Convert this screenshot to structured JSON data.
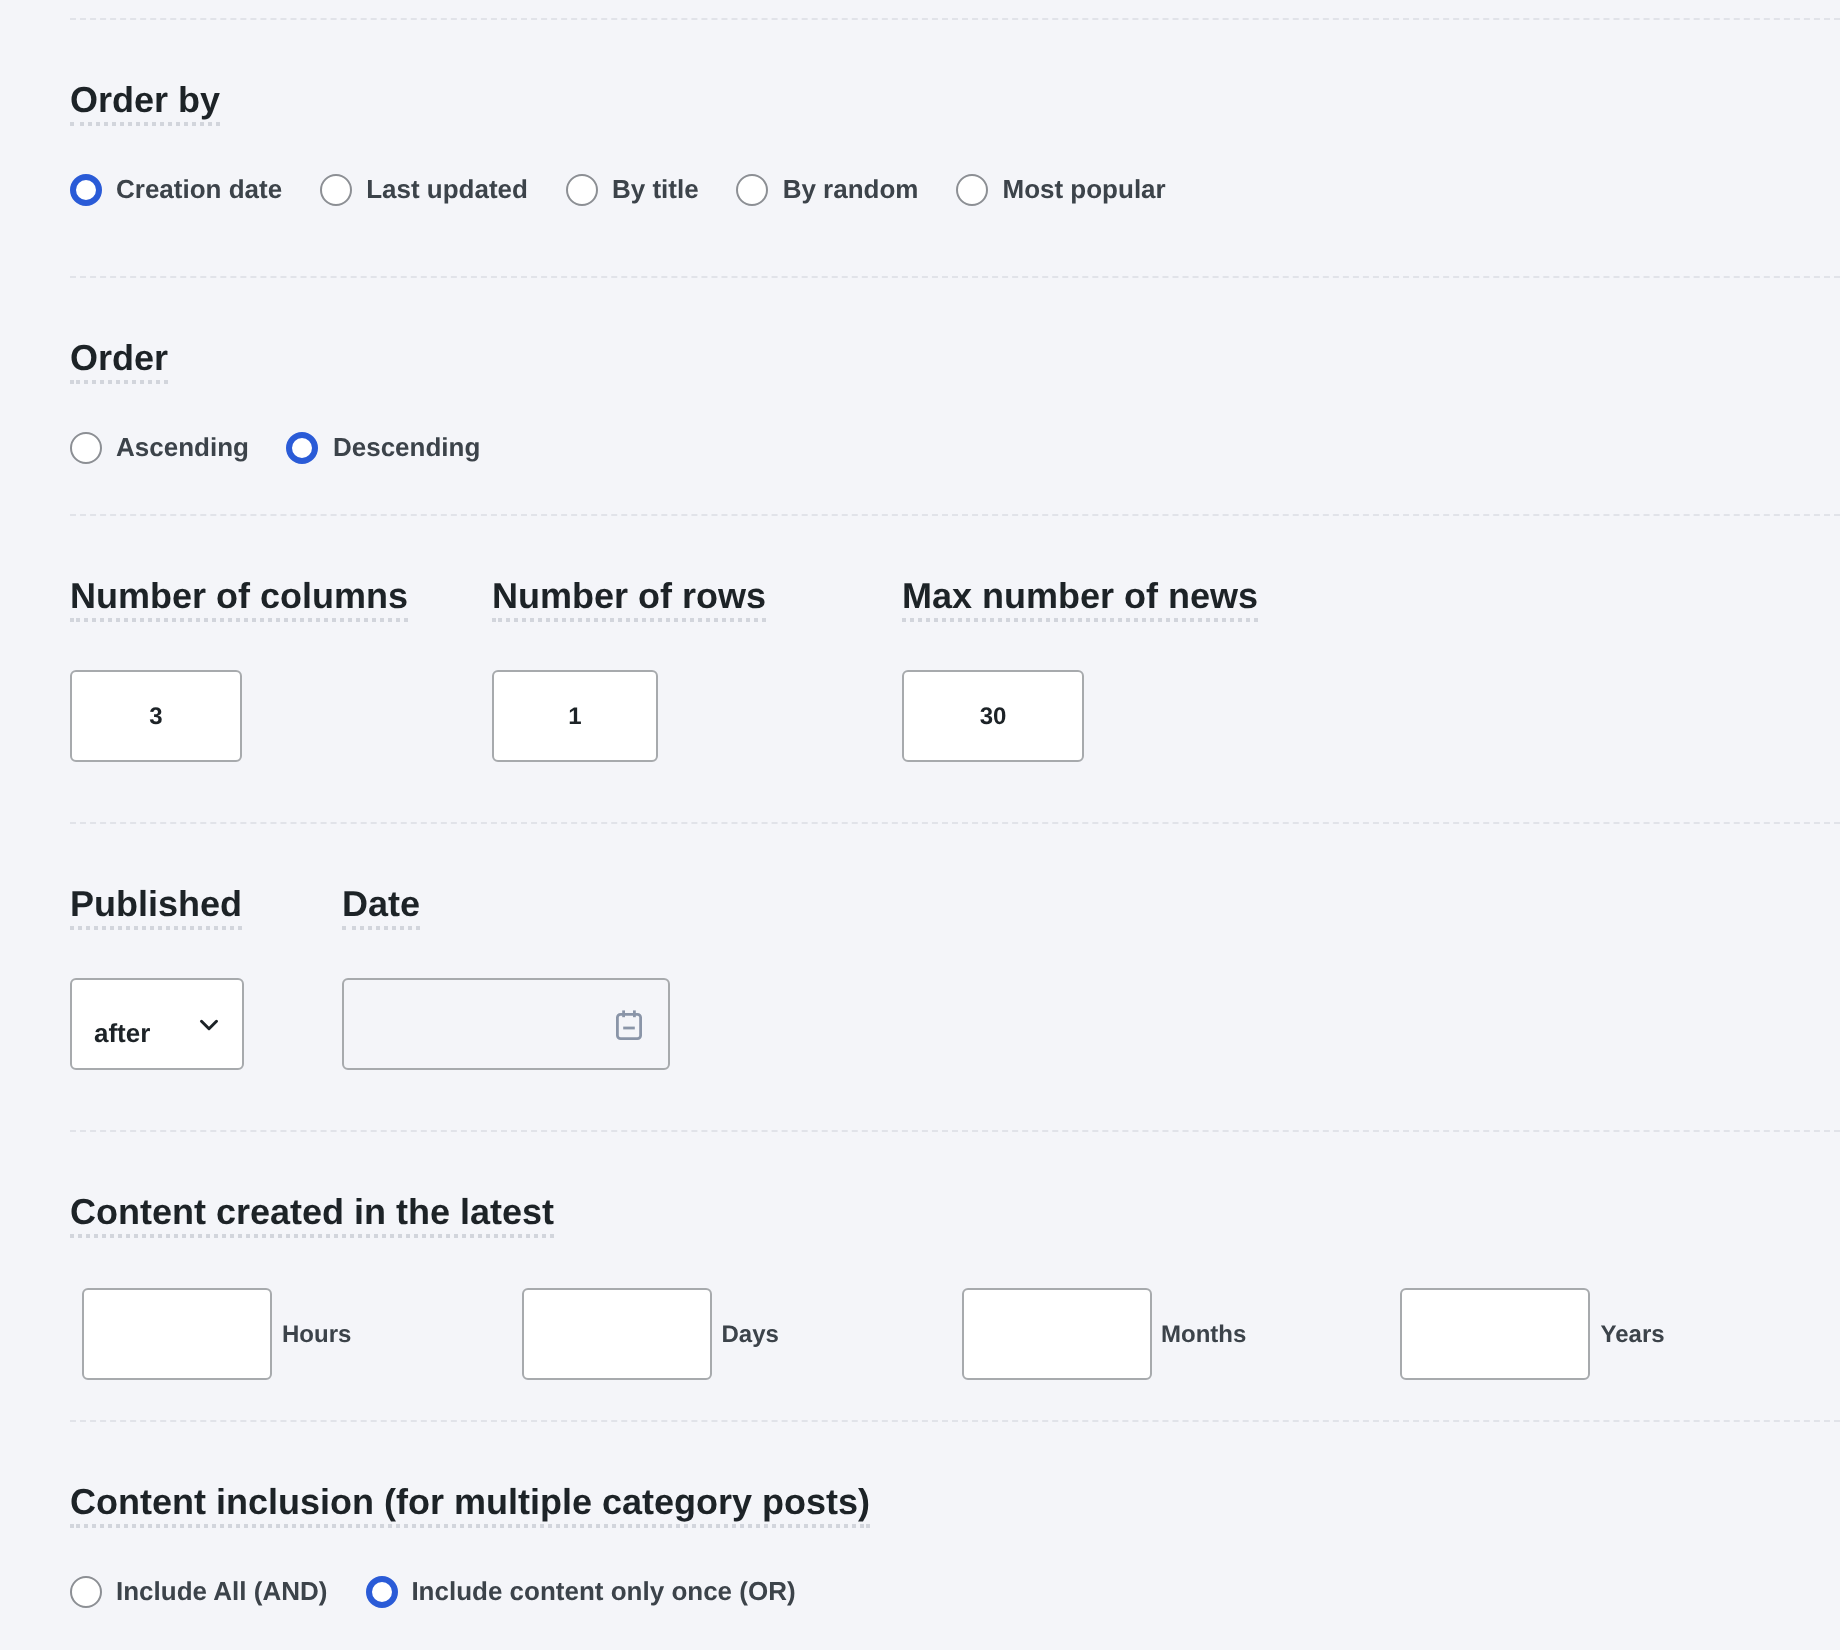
{
  "sections": [
    {
      "kind": "radio_group",
      "title": "Order by",
      "options": [
        {
          "label": "Creation date",
          "selected": true
        },
        {
          "label": "Last updated",
          "selected": false
        },
        {
          "label": "By title",
          "selected": false
        },
        {
          "label": "By random",
          "selected": false
        },
        {
          "label": "Most popular",
          "selected": false
        }
      ]
    },
    {
      "kind": "radio_group",
      "title": "Order",
      "options": [
        {
          "label": "Ascending",
          "selected": false
        },
        {
          "label": "Descending",
          "selected": true
        }
      ]
    },
    {
      "kind": "number_fields",
      "fields": [
        {
          "label": "Number of columns",
          "value": "3"
        },
        {
          "label": "Number of rows",
          "value": "1"
        },
        {
          "label": "Max number of news",
          "value": "30"
        }
      ]
    },
    {
      "kind": "date_filter",
      "select": {
        "label": "Published",
        "value": "after"
      },
      "date": {
        "label": "Date"
      }
    },
    {
      "kind": "period_fields",
      "title": "Content created in the latest",
      "fields": [
        {
          "unit": "Hours"
        },
        {
          "unit": "Days"
        },
        {
          "unit": "Months"
        },
        {
          "unit": "Years"
        }
      ]
    },
    {
      "kind": "radio_group",
      "title": "Content inclusion (for multiple category posts)",
      "options": [
        {
          "label": "Include All (AND)",
          "selected": false
        },
        {
          "label": "Include content only once (OR)",
          "selected": true
        }
      ]
    }
  ]
}
